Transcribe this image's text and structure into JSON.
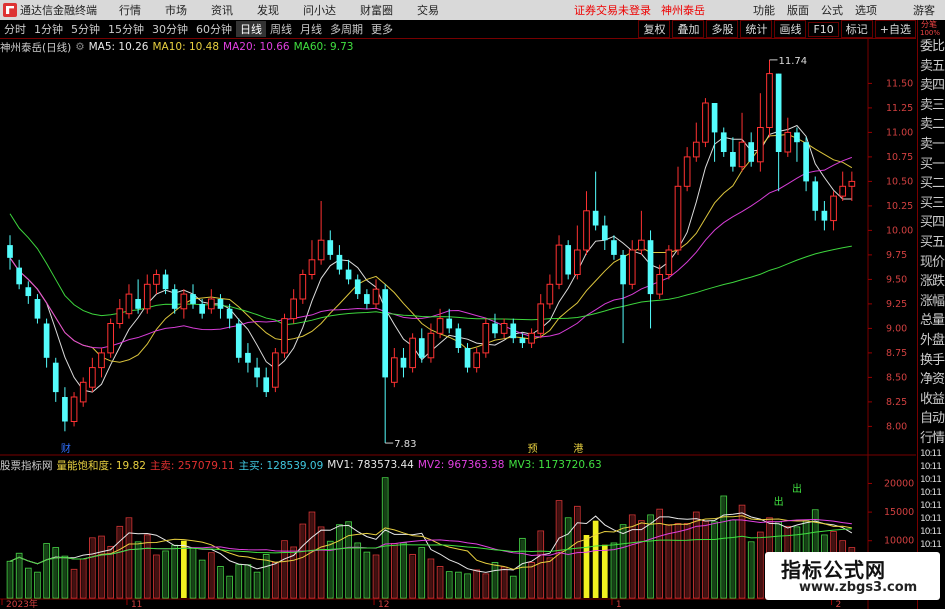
{
  "titlebar": {
    "app_name": "通达信金融终端",
    "menus": [
      "行情",
      "市场",
      "资讯",
      "发现",
      "问小达",
      "财富圈",
      "交易"
    ],
    "warning": "证券交易未登录",
    "stock_name": "神州泰岳",
    "right_items": [
      "功能",
      "版面",
      "公式",
      "选项"
    ],
    "guest": "游客"
  },
  "toolbar": {
    "periods": [
      "分时",
      "1分钟",
      "5分钟",
      "15分钟",
      "30分钟",
      "60分钟",
      "日线",
      "周线",
      "月线",
      "多周期",
      "更多"
    ],
    "active_period": "日线",
    "right_buttons": [
      "复权",
      "叠加",
      "多股",
      "统计",
      "画线",
      "F10",
      "标记",
      "+自选"
    ]
  },
  "legend": {
    "title": "神州泰岳(日线)",
    "ma5": "MA5: 10.26",
    "ma10": "MA10: 10.48",
    "ma20": "MA20: 10.66",
    "ma60": "MA60: 9.73",
    "colors": {
      "ma5": "#e8e8e8",
      "ma10": "#e8d040",
      "ma20": "#e040e0",
      "ma60": "#40e040"
    }
  },
  "indicator": {
    "name": "股票指标网",
    "title": "量能饱和度: 19.82",
    "main_sell": "主卖: 257079.11",
    "main_buy": "主买: 128539.09",
    "mv1": "MV1: 783573.44",
    "mv2": "MV2: 967363.38",
    "mv3": "MV3: 1173720.63"
  },
  "rightbar": [
    "委比",
    "卖五",
    "卖四",
    "卖三",
    "卖二",
    "卖一",
    "买一",
    "买二",
    "买三",
    "买四",
    "买五",
    "现价",
    "涨跌",
    "涨幅",
    "总量",
    "外盘",
    "换手",
    "净资",
    "收益",
    "自动",
    "行情",
    "10:11",
    "10:11",
    "10:11",
    "10:11",
    "10:11",
    "10:11",
    "10:11",
    "10:11"
  ],
  "rightbar_top": [
    "分笔",
    "100%"
  ],
  "watermark": {
    "line1": "指标公式网",
    "line2": "www.zbgs3.com"
  },
  "chart_data": {
    "type": "candlestick",
    "price_axis": {
      "ticks": [
        11.5,
        11.25,
        11.0,
        10.75,
        10.5,
        10.25,
        10.0,
        9.75,
        9.5,
        9.25,
        9.0,
        8.75,
        8.5,
        8.25,
        8.0
      ],
      "range": [
        7.8,
        11.8
      ]
    },
    "volume_axis": {
      "ticks": [
        20000,
        15000,
        10000,
        5000
      ],
      "range": [
        0,
        22000
      ]
    },
    "annotations": {
      "high": "11.74",
      "low": "7.83"
    },
    "x_labels": [
      "2023年",
      "11",
      "12",
      "1",
      "2"
    ],
    "event_markers": [
      "财",
      "预",
      "港"
    ],
    "signals": [
      "出",
      "出"
    ],
    "candles": [
      [
        9.85,
        9.72,
        9.95,
        9.6
      ],
      [
        9.62,
        9.45,
        9.7,
        9.4
      ],
      [
        9.42,
        9.33,
        9.48,
        9.25
      ],
      [
        9.3,
        9.1,
        9.35,
        9.05
      ],
      [
        9.05,
        8.7,
        9.1,
        8.6
      ],
      [
        8.65,
        8.35,
        8.7,
        8.25
      ],
      [
        8.3,
        8.05,
        8.4,
        7.95
      ],
      [
        8.05,
        8.3,
        8.35,
        8.0
      ],
      [
        8.25,
        8.45,
        8.5,
        8.2
      ],
      [
        8.4,
        8.6,
        8.7,
        8.35
      ],
      [
        8.6,
        8.75,
        8.8,
        8.5
      ],
      [
        8.75,
        9.05,
        9.1,
        8.7
      ],
      [
        9.05,
        9.2,
        9.3,
        9.0
      ],
      [
        9.15,
        9.35,
        9.45,
        9.1
      ],
      [
        9.3,
        9.2,
        9.5,
        9.15
      ],
      [
        9.2,
        9.45,
        9.55,
        9.15
      ],
      [
        9.45,
        9.55,
        9.6,
        9.35
      ],
      [
        9.55,
        9.4,
        9.6,
        9.35
      ],
      [
        9.4,
        9.2,
        9.45,
        9.15
      ],
      [
        9.2,
        9.35,
        9.4,
        9.1
      ],
      [
        9.35,
        9.25,
        9.45,
        9.2
      ],
      [
        9.25,
        9.15,
        9.3,
        9.1
      ],
      [
        9.2,
        9.3,
        9.4,
        9.15
      ],
      [
        9.3,
        9.2,
        9.35,
        9.1
      ],
      [
        9.2,
        9.1,
        9.25,
        9.0
      ],
      [
        9.05,
        8.7,
        9.1,
        8.65
      ],
      [
        8.75,
        8.65,
        8.85,
        8.55
      ],
      [
        8.6,
        8.5,
        8.7,
        8.4
      ],
      [
        8.5,
        8.35,
        8.6,
        8.3
      ],
      [
        8.4,
        8.75,
        8.8,
        8.35
      ],
      [
        8.75,
        9.1,
        9.15,
        8.7
      ],
      [
        9.1,
        9.3,
        9.4,
        9.05
      ],
      [
        9.3,
        9.55,
        9.6,
        9.25
      ],
      [
        9.55,
        9.7,
        9.9,
        9.5
      ],
      [
        9.7,
        9.9,
        10.3,
        9.65
      ],
      [
        9.9,
        9.75,
        10.0,
        9.7
      ],
      [
        9.75,
        9.6,
        9.85,
        9.55
      ],
      [
        9.6,
        9.5,
        9.7,
        9.45
      ],
      [
        9.5,
        9.35,
        9.55,
        9.3
      ],
      [
        9.35,
        9.25,
        9.4,
        9.2
      ],
      [
        9.25,
        9.4,
        9.5,
        9.2
      ],
      [
        9.4,
        8.5,
        9.45,
        7.83
      ],
      [
        8.45,
        8.7,
        8.8,
        8.4
      ],
      [
        8.7,
        8.6,
        8.8,
        8.5
      ],
      [
        8.6,
        8.9,
        8.95,
        8.55
      ],
      [
        8.9,
        8.7,
        9.0,
        8.65
      ],
      [
        8.7,
        8.95,
        9.05,
        8.65
      ],
      [
        8.95,
        9.1,
        9.2,
        8.9
      ],
      [
        9.1,
        9.0,
        9.2,
        8.95
      ],
      [
        9.0,
        8.8,
        9.05,
        8.75
      ],
      [
        8.8,
        8.6,
        8.85,
        8.55
      ],
      [
        8.6,
        8.75,
        8.8,
        8.55
      ],
      [
        8.75,
        9.05,
        9.1,
        8.7
      ],
      [
        9.05,
        8.95,
        9.15,
        8.9
      ],
      [
        8.95,
        9.05,
        9.1,
        8.9
      ],
      [
        9.05,
        8.9,
        9.1,
        8.85
      ],
      [
        8.9,
        8.85,
        8.95,
        8.8
      ],
      [
        8.85,
        8.95,
        9.0,
        8.8
      ],
      [
        8.95,
        9.25,
        9.35,
        8.9
      ],
      [
        9.25,
        9.45,
        9.55,
        9.2
      ],
      [
        9.45,
        9.85,
        9.95,
        9.4
      ],
      [
        9.85,
        9.55,
        9.9,
        9.5
      ],
      [
        9.55,
        9.8,
        10.05,
        9.5
      ],
      [
        9.8,
        10.2,
        10.4,
        9.75
      ],
      [
        10.2,
        10.05,
        10.6,
        10.0
      ],
      [
        10.05,
        9.9,
        10.15,
        9.8
      ],
      [
        9.9,
        9.75,
        9.95,
        9.7
      ],
      [
        9.75,
        9.45,
        9.8,
        8.85
      ],
      [
        9.45,
        9.8,
        9.9,
        9.4
      ],
      [
        9.8,
        9.9,
        10.2,
        9.75
      ],
      [
        9.9,
        9.35,
        10.0,
        9.0
      ],
      [
        9.35,
        9.55,
        9.65,
        9.3
      ],
      [
        9.55,
        9.8,
        9.85,
        9.5
      ],
      [
        9.8,
        10.45,
        10.65,
        9.75
      ],
      [
        10.45,
        10.75,
        10.85,
        10.4
      ],
      [
        10.75,
        10.9,
        11.1,
        10.7
      ],
      [
        10.9,
        11.3,
        11.35,
        10.85
      ],
      [
        11.3,
        11.0,
        11.3,
        10.7
      ],
      [
        11.0,
        10.8,
        11.05,
        10.75
      ],
      [
        10.8,
        10.65,
        10.95,
        10.6
      ],
      [
        10.65,
        10.9,
        11.2,
        10.6
      ],
      [
        10.9,
        10.7,
        11.0,
        10.65
      ],
      [
        10.7,
        11.05,
        11.4,
        10.6
      ],
      [
        11.05,
        11.6,
        11.74,
        10.95
      ],
      [
        11.6,
        10.8,
        11.6,
        10.4
      ],
      [
        10.8,
        11.0,
        11.15,
        10.75
      ],
      [
        11.0,
        10.9,
        11.05,
        10.7
      ],
      [
        10.9,
        10.5,
        10.95,
        10.4
      ],
      [
        10.5,
        10.2,
        10.55,
        10.1
      ],
      [
        10.2,
        10.1,
        10.3,
        10.0
      ],
      [
        10.1,
        10.35,
        10.4,
        10.0
      ],
      [
        10.35,
        10.45,
        10.6,
        10.3
      ],
      [
        10.45,
        10.5,
        10.6,
        10.3
      ]
    ],
    "volumes": [
      6400,
      7800,
      5200,
      4500,
      9500,
      8800,
      7300,
      5000,
      6800,
      10500,
      10800,
      9000,
      12500,
      14000,
      9800,
      11000,
      7500,
      8200,
      9200,
      10000,
      8700,
      6600,
      7900,
      5500,
      3800,
      5800,
      5800,
      4500,
      7600,
      6200,
      10000,
      8900,
      12900,
      15000,
      12400,
      9900,
      12800,
      13300,
      9600,
      8000,
      7500,
      21000,
      9500,
      9600,
      7600,
      8800,
      6800,
      5500,
      4600,
      4500,
      4200,
      4900,
      4200,
      6200,
      5400,
      3800,
      10400,
      6200,
      11700,
      7000,
      17000,
      14000,
      16000,
      11000,
      13500,
      9300,
      9600,
      12800,
      14500,
      13500,
      14500,
      15500,
      12800,
      13000,
      13000,
      15000,
      13400,
      13300,
      17800,
      13600,
      16200,
      9800,
      11500,
      14000,
      13300,
      12500,
      12400,
      13500,
      15400,
      11000,
      11600,
      10000,
      8800
    ]
  }
}
